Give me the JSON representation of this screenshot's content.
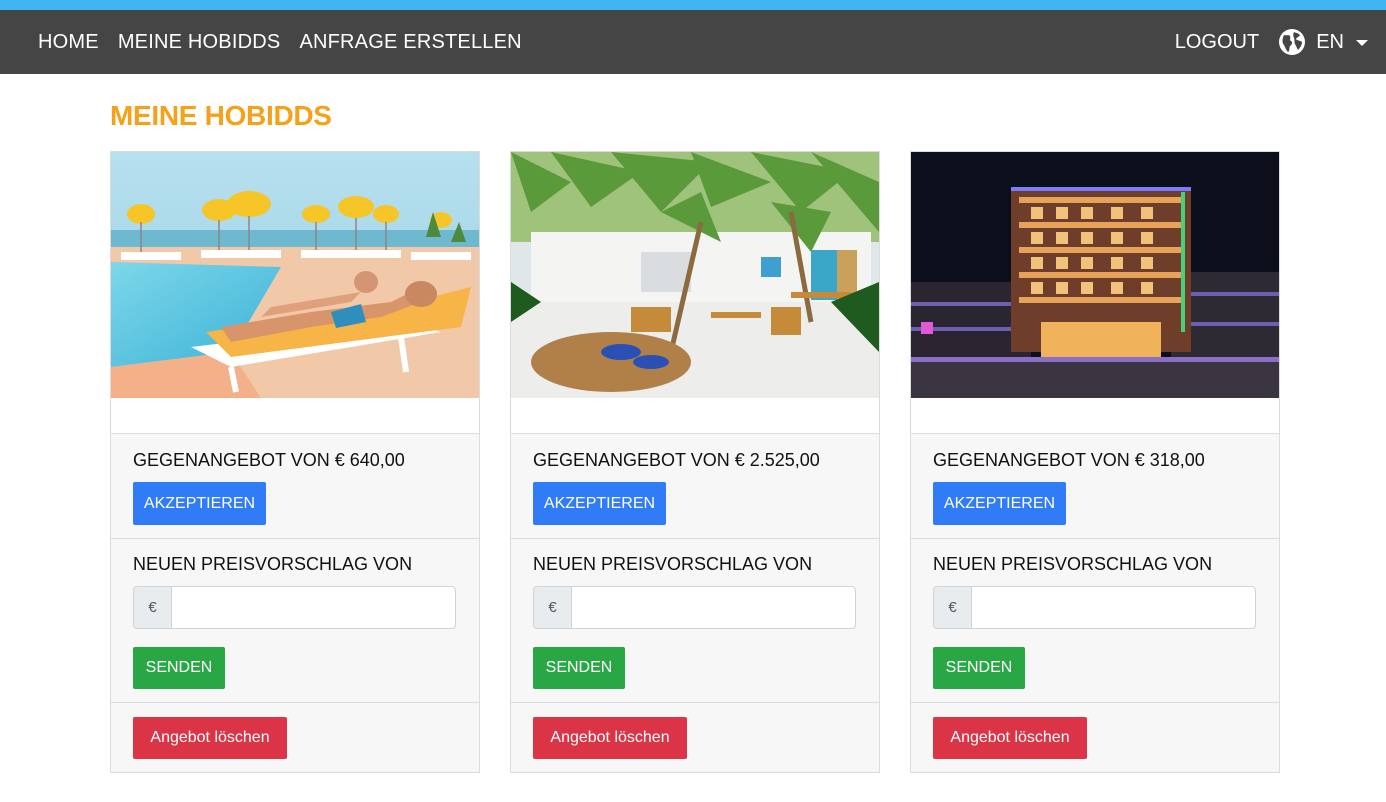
{
  "nav": {
    "links": [
      "HOME",
      "MEINE HOBIDDS",
      "ANFRAGE ERSTELLEN"
    ],
    "logout": "LOGOUT",
    "language": "EN"
  },
  "page": {
    "title": "MEINE HOBIDDS"
  },
  "offers": [
    {
      "image": "pool-beach-resort-photo",
      "counter_offer": "GEGENANGEBOT VON € 640,00",
      "accept_label": "AKZEPTIEREN",
      "propose_label": "NEUEN PREISVORSCHLAG VON",
      "currency": "€",
      "price_value": "",
      "send_label": "SENDEN",
      "delete_label": "Angebot löschen"
    },
    {
      "image": "palm-courtyard-photo",
      "counter_offer": "GEGENANGEBOT VON € 2.525,00",
      "accept_label": "AKZEPTIEREN",
      "propose_label": "NEUEN PREISVORSCHLAG VON",
      "currency": "€",
      "price_value": "",
      "send_label": "SENDEN",
      "delete_label": "Angebot löschen"
    },
    {
      "image": "hotel-night-photo",
      "counter_offer": "GEGENANGEBOT VON € 318,00",
      "accept_label": "AKZEPTIEREN",
      "propose_label": "NEUEN PREISVORSCHLAG VON",
      "currency": "€",
      "price_value": "",
      "send_label": "SENDEN",
      "delete_label": "Angebot löschen"
    }
  ],
  "colors": {
    "accent_bar": "#3fb5f2",
    "navbar": "#454545",
    "title": "#f5a11a",
    "accept": "#2f7cf6",
    "send": "#2aa745",
    "delete": "#dc3447"
  }
}
